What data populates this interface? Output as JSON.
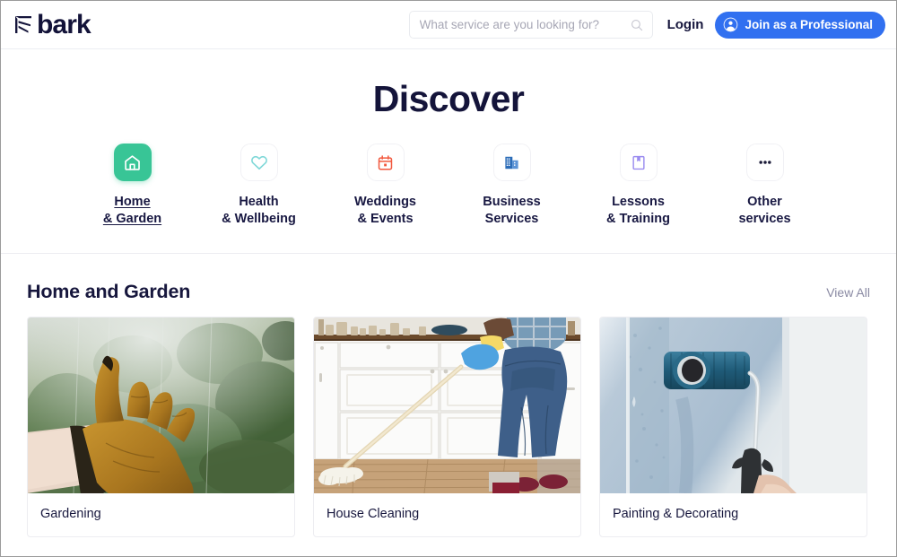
{
  "header": {
    "logo_text": "bark",
    "logo_icon": "bark-logo-mark",
    "search": {
      "placeholder": "What service are you looking for?",
      "value": "",
      "icon": "search-icon"
    },
    "login_label": "Login",
    "join_label": "Join as a Professional",
    "join_icon": "user-avatar-icon",
    "accent_blue": "#3170f0"
  },
  "page_title": "Discover",
  "categories": [
    {
      "line1": "Home",
      "line2": "& Garden",
      "icon": "house-icon",
      "icon_color": "#ffffff",
      "tile_color": "#38c596",
      "active": true
    },
    {
      "line1": "Health",
      "line2": "& Wellbeing",
      "icon": "heart-icon",
      "icon_color": "#7fd8d8",
      "tile_color": "#ffffff",
      "active": false
    },
    {
      "line1": "Weddings",
      "line2": "& Events",
      "icon": "calendar-icon",
      "icon_color": "#f2593f",
      "tile_color": "#ffffff",
      "active": false
    },
    {
      "line1": "Business",
      "line2": "Services",
      "icon": "office-building-icon",
      "icon_color": "#2b6cb8",
      "tile_color": "#ffffff",
      "active": false
    },
    {
      "line1": "Lessons",
      "line2": "& Training",
      "icon": "book-icon",
      "icon_color": "#9b8cf0",
      "tile_color": "#ffffff",
      "active": false
    },
    {
      "line1": "Other",
      "line2": "services",
      "icon": "ellipsis-icon",
      "icon_color": "#1a1a38",
      "tile_color": "#ffffff",
      "active": false
    }
  ],
  "section": {
    "title": "Home and Garden",
    "view_all_label": "View All",
    "cards": [
      {
        "title": "Gardening",
        "image": "gloved-hand-reaching-toward-green-foliage"
      },
      {
        "title": "House Cleaning",
        "image": "person-mopping-kitchen-floor-white-cabinets"
      },
      {
        "title": "Painting & Decorating",
        "image": "paint-roller-on-light-blue-wall"
      }
    ]
  }
}
